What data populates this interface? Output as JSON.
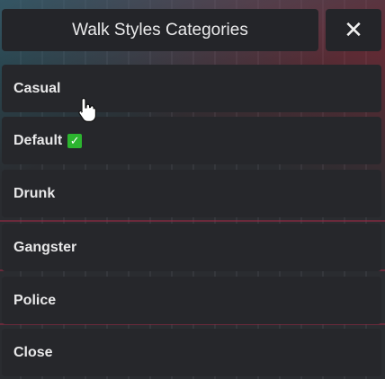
{
  "header": {
    "title": "Walk Styles Categories",
    "close_glyph": "✕"
  },
  "menu": {
    "items": [
      {
        "label": "Casual"
      },
      {
        "label": "Default",
        "checked_glyph": "✓"
      },
      {
        "label": "Drunk"
      },
      {
        "label": "Gangster"
      },
      {
        "label": "Police"
      },
      {
        "label": "Close"
      }
    ]
  },
  "icons": {
    "close": "close-icon",
    "check": "checkmark-icon",
    "cursor": "hand-pointer-icon"
  },
  "colors": {
    "panel": "#26272b",
    "text": "#e8e8e9",
    "check": "#2cb52f"
  }
}
